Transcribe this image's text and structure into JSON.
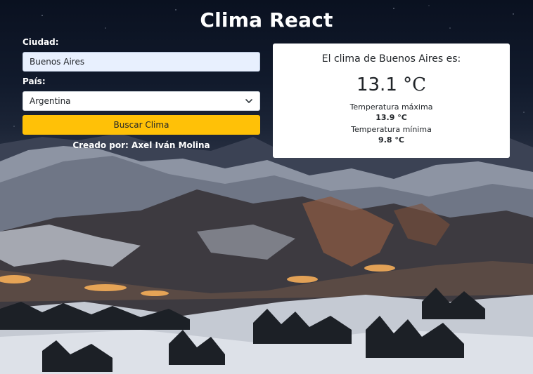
{
  "app": {
    "title": "Clima React"
  },
  "form": {
    "city_label": "Ciudad:",
    "city_value": "Buenos Aires",
    "country_label": "País:",
    "country_value": "Argentina",
    "search_button": "Buscar Clima",
    "credit": "Creado por: Axel Iván Molina"
  },
  "weather": {
    "heading": "El clima de Buenos Aires es:",
    "current_temp": "13.1",
    "unit": "°C",
    "max_label": "Temperatura máxima",
    "max_value": "13.9 °C",
    "min_label": "Temperatura mínima",
    "min_value": "9.8 °C"
  },
  "colors": {
    "button": "#ffc107",
    "input_autofill": "#e8f0fe",
    "card": "#ffffff"
  }
}
